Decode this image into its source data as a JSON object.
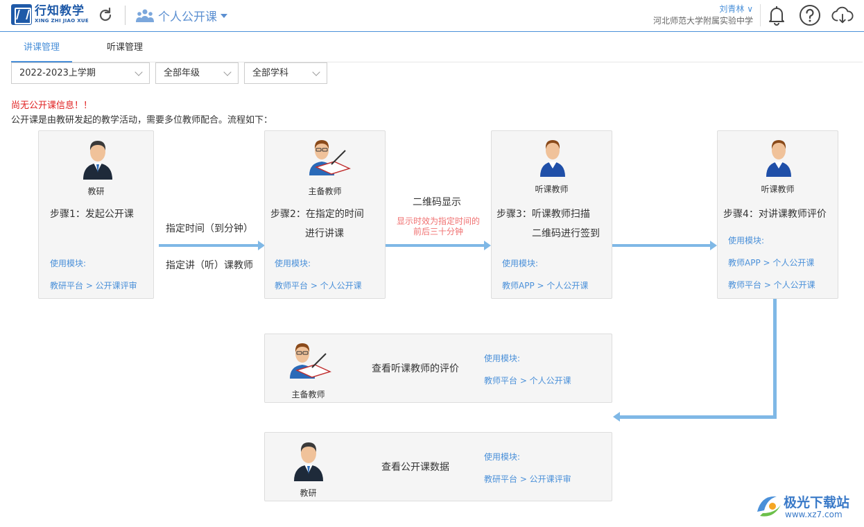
{
  "header": {
    "logo_cn": "行知教学",
    "logo_en": "XING ZHI JIAO XUE",
    "module": "个人公开课",
    "user_name": "刘青林 ∨",
    "user_school": "河北师范大学附属实验中学"
  },
  "tabs": [
    {
      "label": "讲课管理"
    },
    {
      "label": "听课管理"
    }
  ],
  "filters": {
    "term": "2022-2023上学期",
    "grade": "全部年级",
    "subject": "全部学科"
  },
  "notice": "尚无公开课信息！！",
  "description": "公开课是由教研发起的教学活动，需要多位教师配合。流程如下：",
  "steps": [
    {
      "role": "教研",
      "text1": "步骤1：发起公开课",
      "text2": "",
      "module_label": "使用模块:",
      "links": [
        "教研平台 > 公开课评审"
      ]
    },
    {
      "role": "主备教师",
      "text1": "步骤2：在指定的时间",
      "text2": "进行讲课",
      "module_label": "使用模块:",
      "links": [
        "教师平台 > 个人公开课"
      ]
    },
    {
      "role": "听课教师",
      "text1": "步骤3：听课教师扫描",
      "text2": "二维码进行签到",
      "module_label": "使用模块:",
      "links": [
        "教师APP > 个人公开课"
      ]
    },
    {
      "role": "听课教师",
      "text1": "步骤4：对讲课教师评价",
      "text2": "",
      "module_label": "使用模块:",
      "links": [
        "教师APP > 个人公开课",
        "教师平台 > 个人公开课"
      ]
    }
  ],
  "connectors": {
    "c1_top": "指定时间（到分钟）",
    "c1_bottom": "指定讲（听）课教师",
    "c2_top": "二维码显示",
    "c2_note": "显示时效为指定时间的前后三十分钟"
  },
  "bottom_cards": [
    {
      "role": "主备教师",
      "text": "查看听课教师的评价",
      "module_label": "使用模块:",
      "link": "教师平台 > 个人公开课"
    },
    {
      "role": "教研",
      "text": "查看公开课数据",
      "module_label": "使用模块:",
      "link": "教研平台 > 公开课评审"
    }
  ],
  "watermark": {
    "cn": "极光下载站",
    "url": "www.xz7.com"
  },
  "colors": {
    "accent": "#4a90d9",
    "brand": "#1f5aa8",
    "arrow": "#7fb8e6",
    "warning": "#e02020"
  }
}
